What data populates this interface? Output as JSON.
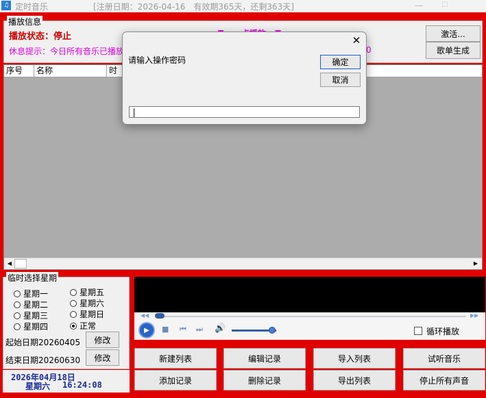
{
  "titlebar": {
    "app_icon": "app-icon",
    "title": "定时音乐",
    "reg_info": "[注册日期：2026-04-16　有效期365天，还剩363天]",
    "min_glyph": "—",
    "max_glyph": "☐"
  },
  "play_info": {
    "group_label": "播放信息",
    "status": "播放状态：停止",
    "rest_tip": "休息提示：今日所有音乐已播放",
    "magenta_mid": "T　...点播放...T",
    "magenta_right": "0",
    "activate_label": "激活...",
    "playlist_gen_label": "歌单生成"
  },
  "list": {
    "columns": [
      "序号",
      "名称",
      "时"
    ],
    "scroll_left": "◀",
    "scroll_right": "▶"
  },
  "modal": {
    "close_glyph": "✕",
    "prompt": "请输入操作密码",
    "ok_label": "确定",
    "cancel_label": "取消",
    "input_value": "|"
  },
  "week": {
    "group_label": "临时选择星期",
    "options": [
      {
        "label": "星期一",
        "selected": false
      },
      {
        "label": "星期二",
        "selected": false
      },
      {
        "label": "星期三",
        "selected": false
      },
      {
        "label": "星期四",
        "selected": false
      },
      {
        "label": "星期五",
        "selected": false
      },
      {
        "label": "星期六",
        "selected": false
      },
      {
        "label": "星期日",
        "selected": false
      },
      {
        "label": "正常",
        "selected": true
      }
    ],
    "start_date": "起始日期20260405",
    "end_date": "结束日期20260630",
    "edit_label": "修改"
  },
  "clock": {
    "date": "2026年04月18日",
    "weekday": "星期六",
    "time": "16:24:08"
  },
  "player": {
    "seek_start_glyph": "◀◀",
    "seek_end_glyph": "▶▶",
    "play_glyph": "▶",
    "stop_glyph": "■",
    "prev_glyph": "⏮",
    "next_glyph": "⏭",
    "volume_glyph": "🔊",
    "loop_label": "循环播放",
    "loop_checked": false
  },
  "buttons": {
    "new_list": "新建列表",
    "add_record": "添加记录",
    "edit_record": "编辑记录",
    "delete_record": "删除记录",
    "import_list": "导入列表",
    "export_list": "导出列表",
    "test_music": "试听音乐",
    "stop_all": "停止所有声音"
  },
  "colors": {
    "frame_red": "#e00000",
    "status_red": "#cc0000",
    "tip_magenta": "#e000e0",
    "clock_blue": "#1a2a9a",
    "player_blue": "#2b62c5"
  }
}
